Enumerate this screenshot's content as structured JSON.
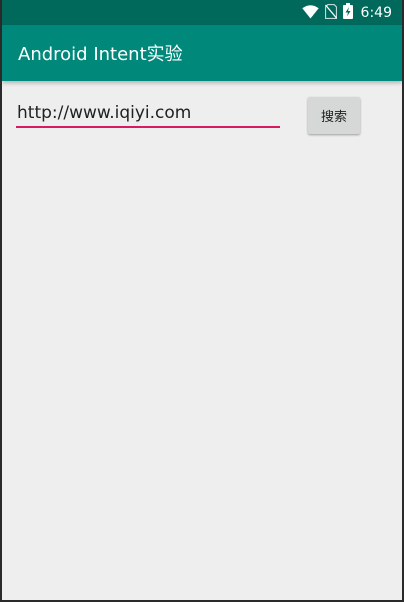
{
  "status_bar": {
    "time": "6:49",
    "icons": [
      "wifi-icon",
      "no-sim-icon",
      "battery-charging-icon"
    ],
    "color": "#00695c"
  },
  "app_bar": {
    "title": "Android Intent实验",
    "color": "#00897b"
  },
  "form": {
    "url_value": "http://www.iqiyi.com",
    "search_label": "搜索",
    "underline_color": "#d81b60"
  }
}
